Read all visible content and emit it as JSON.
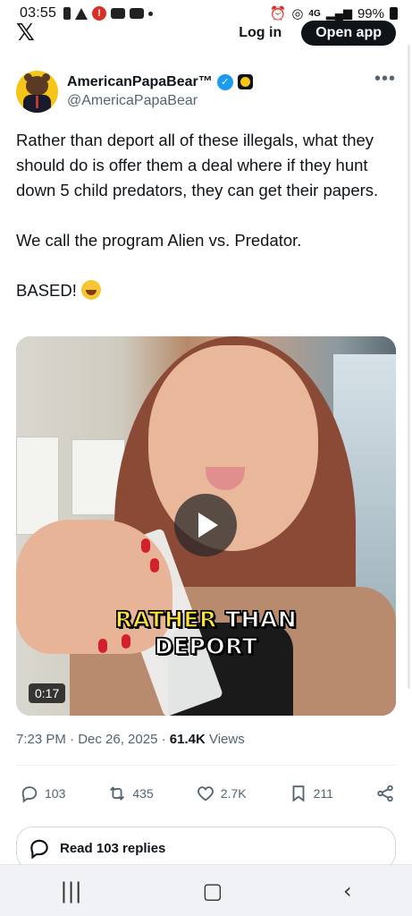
{
  "status_bar": {
    "time": "03:55",
    "battery": "99%",
    "left_icons": [
      "sim-icon",
      "warning-icon",
      "alert-icon",
      "youtube-icon",
      "youtube-icon",
      "dot-icon"
    ],
    "right_icons": [
      "alarm-icon",
      "hotspot-icon",
      "network-4g-icon",
      "signal-icon",
      "battery-icon"
    ],
    "network_label": "4G"
  },
  "top_nav": {
    "logo": "𝕏",
    "login_label": "Log in",
    "open_app_label": "Open app"
  },
  "post": {
    "display_name": "AmericanPapaBear™",
    "handle": "@AmericaPapaBear",
    "verified": true,
    "more_label": "•••",
    "text_paragraphs": [
      "Rather than deport all of these illegals, what they should do is offer them a deal where if they hunt down 5 child predators, they can get their papers.",
      "We call the program Alien vs. Predator.",
      "BASED!"
    ],
    "emoji": "rolling-on-floor-laughing-emoji",
    "video": {
      "caption_word1": "RATHER",
      "caption_word2": "THAN",
      "caption_line2": "DEPORT",
      "duration": "0:17"
    },
    "timestamp": "7:23 PM · Dec 26, 2025 · ",
    "views_count": "61.4K",
    "views_label": " Views",
    "actions": {
      "replies": "103",
      "reposts": "435",
      "likes": "2.7K",
      "bookmarks": "211"
    },
    "read_replies_label": "Read 103 replies"
  },
  "colors": {
    "text": "#0f1419",
    "secondary": "#536471",
    "verified_blue": "#1d9bf0",
    "caption_yellow": "#ffe23d"
  }
}
